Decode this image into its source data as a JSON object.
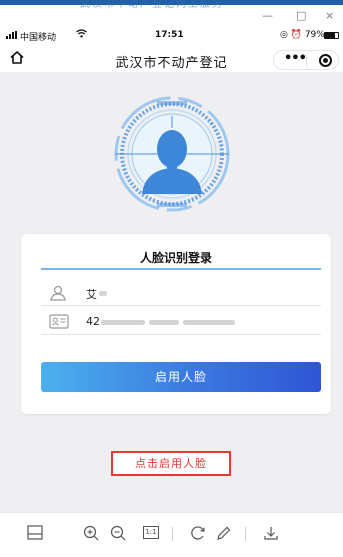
{
  "window": {
    "ghost_title": "武汉市不动产登记网上服务",
    "minimize": "—",
    "maximize": "□",
    "close": "×"
  },
  "statusbar": {
    "carrier": "中国移动",
    "time": "17:51",
    "battery_percent": "79%"
  },
  "navbar": {
    "title": "武汉市不动产登记",
    "more": "•••"
  },
  "illustration": {
    "icon": "face-recognition-icon"
  },
  "login_card": {
    "title": "人脸识别登录",
    "name_value": "艾",
    "id_value": "42",
    "button_label": "启用人脸"
  },
  "annotation": {
    "hint": "点击启用人脸"
  },
  "toolbar": {
    "fit_label": "1:1"
  },
  "colors": {
    "accent": "#3b78df",
    "hint_red": "#e53935",
    "background": "#efeff1"
  }
}
